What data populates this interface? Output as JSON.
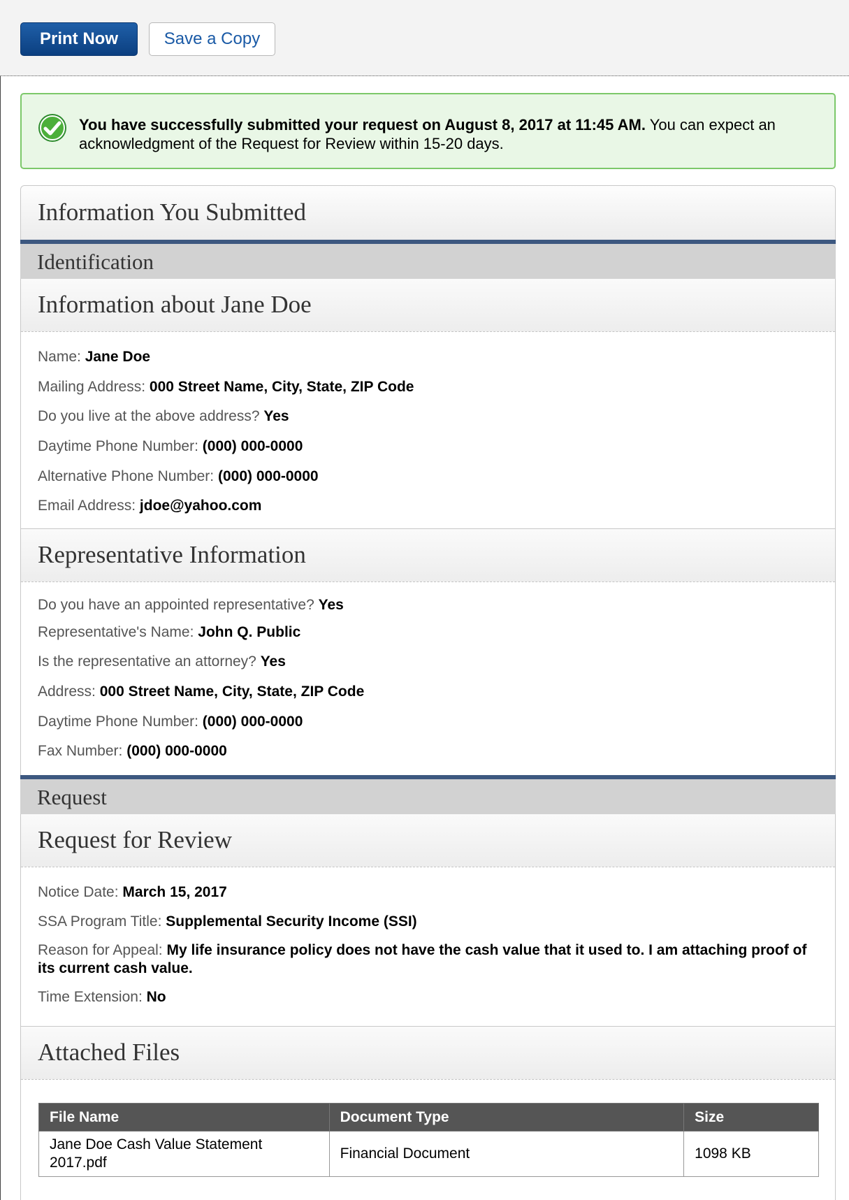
{
  "toolbar": {
    "print_label": "Print Now",
    "copy_label": "Save a Copy"
  },
  "alert": {
    "icon": "check-circle-icon",
    "bold_text": "You have successfully submitted your request on August 8, 2017 at 11:45 AM.",
    "text": " You can expect an acknowledgment of the Request for Review within 15-20 days."
  },
  "page_title": "Information You Submitted",
  "identification": {
    "band_title": "Identification",
    "person": {
      "title": "Information about Jane Doe",
      "fields": [
        {
          "label": "Name:",
          "value": "Jane Doe"
        },
        {
          "label": "Mailing Address:",
          "value": "000 Street Name, City, State, ZIP Code"
        },
        {
          "label": "Do you live at the above address?",
          "value": "Yes"
        },
        {
          "label": "Daytime Phone Number:",
          "value": "(000) 000-0000"
        },
        {
          "label": "Alternative Phone Number:",
          "value": "(000) 000-0000"
        },
        {
          "label": "Email Address:",
          "value": "jdoe@yahoo.com"
        }
      ]
    },
    "representative": {
      "title": "Representative Information",
      "fields": [
        {
          "label": "Do you have an appointed representative?",
          "value": "Yes"
        },
        {
          "label": "Representative's Name:",
          "value": "John Q. Public"
        },
        {
          "label": "Is the representative an attorney?",
          "value": "Yes"
        },
        {
          "label": "Address:",
          "value": "000 Street Name, City, State, ZIP Code"
        },
        {
          "label": "Daytime Phone Number:",
          "value": "(000) 000-0000"
        },
        {
          "label": "Fax Number:",
          "value": "(000) 000-0000"
        }
      ]
    }
  },
  "request": {
    "band_title": "Request",
    "review": {
      "title": "Request for Review",
      "fields": [
        {
          "label": "Notice Date:",
          "value": "March 15, 2017"
        },
        {
          "label": "SSA Program Title:",
          "value": "Supplemental Security Income (SSI)"
        },
        {
          "label": "Reason for Appeal:",
          "value": "My life insurance policy does not have the cash value that it used to. I am attaching proof of its current cash value."
        },
        {
          "label": "Time Extension:",
          "value": "No"
        }
      ]
    },
    "files": {
      "title": "Attached Files",
      "columns": [
        "File Name",
        "Document Type",
        "Size"
      ],
      "rows": [
        [
          "Jane Doe Cash Value Statement 2017.pdf",
          "Financial Document",
          "1098 KB"
        ]
      ]
    }
  }
}
